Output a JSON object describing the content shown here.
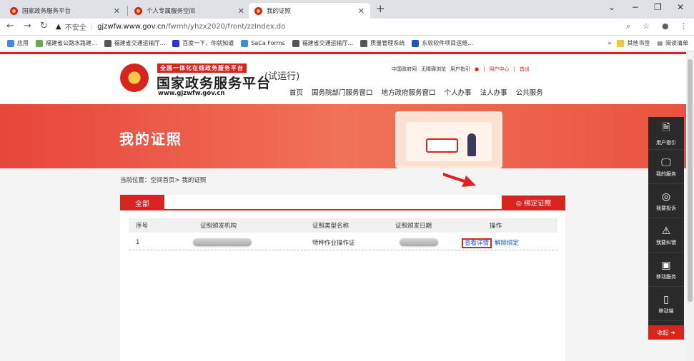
{
  "browser": {
    "tabs": [
      {
        "label": "国家政务服务平台"
      },
      {
        "label": "个人专属服务空间"
      },
      {
        "label": "我的证照"
      }
    ],
    "url_security": "不安全",
    "url_host": "gjzwfw.www.gov.cn",
    "url_path": "/fwmh/yhzx2020/front/zzIndex.do",
    "bookmarks": [
      {
        "label": "应用",
        "icon": "apps-icon",
        "color": "#4285f4"
      },
      {
        "label": "福建省公路水路建...",
        "icon": "doc-icon",
        "color": "#6aa84f"
      },
      {
        "label": "福建省交通运输厅...",
        "icon": "globe-icon",
        "color": "#555555"
      },
      {
        "label": "百度一下，你就知道",
        "icon": "baidu-icon",
        "color": "#2932e1"
      },
      {
        "label": "SaCa Forms",
        "icon": "saca-icon",
        "color": "#3b8ed6"
      },
      {
        "label": "福建省交通运输厅...",
        "icon": "globe-icon",
        "color": "#555555"
      },
      {
        "label": "质量管理系统",
        "icon": "globe-icon",
        "color": "#555555"
      },
      {
        "label": "东软软件项目运维...",
        "icon": "neusoft-icon",
        "color": "#1a5bb8"
      }
    ],
    "other_bookmarks": "其他书签",
    "reading_list": "阅读清单"
  },
  "header": {
    "logo_tagline": "全国一体化在线政务服务平台",
    "logo_title": "国家政务服务平台",
    "logo_url": "www.gjzwfw.gov.cn",
    "trial": "(试运行)",
    "top_links": [
      "中国政府网",
      "无障碍浏览",
      "用户指引",
      "|",
      "用户中心",
      "|",
      "首出"
    ],
    "nav": [
      "首页",
      "国务院部门服务窗口",
      "地方政府服务窗口",
      "个人办事",
      "法人办事",
      "公共服务"
    ]
  },
  "banner": {
    "title": "我的证照"
  },
  "breadcrumb": "当前位置：空间首页> 我的证照",
  "panel": {
    "tab_all": "全部",
    "bind_button": "◎ 绑定证照",
    "columns": [
      "序号",
      "证照颁发机构",
      "证照类型名称",
      "证照颁发日期",
      "操作"
    ],
    "rows": [
      {
        "index": "1",
        "type": "特种作业操作证",
        "view": "查看详情",
        "unbind": "解除绑定"
      }
    ]
  },
  "sidebar": {
    "items": [
      {
        "label": "用户指引",
        "icon": "guide-icon",
        "glyph": "🗎"
      },
      {
        "label": "我的服务",
        "icon": "monitor-icon",
        "glyph": "🖵"
      },
      {
        "label": "我要投诉",
        "icon": "complaint-icon",
        "glyph": "◎"
      },
      {
        "label": "我要纠错",
        "icon": "error-icon",
        "glyph": "⚠"
      },
      {
        "label": "移动服务",
        "icon": "mobile-service-icon",
        "glyph": "▣"
      },
      {
        "label": "移动端",
        "icon": "phone-icon",
        "glyph": "▯"
      }
    ],
    "collapse": "收起 ➔"
  },
  "colors": {
    "accent": "#d9231d",
    "link": "#1b5bd6"
  }
}
